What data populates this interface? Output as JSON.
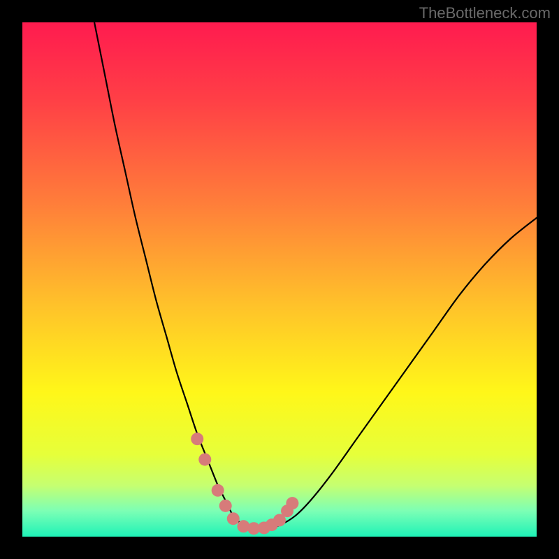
{
  "watermark": "TheBottleneck.com",
  "chart_data": {
    "type": "line",
    "title": "",
    "xlabel": "",
    "ylabel": "",
    "xlim": [
      0,
      100
    ],
    "ylim": [
      0,
      100
    ],
    "curve": {
      "x": [
        14,
        16,
        18,
        20,
        22,
        24,
        26,
        28,
        30,
        32,
        34,
        36,
        38,
        39,
        40,
        41,
        42,
        43,
        44,
        45,
        46,
        48,
        50,
        53,
        56,
        60,
        65,
        70,
        75,
        80,
        85,
        90,
        95,
        100
      ],
      "y": [
        100,
        90,
        80,
        71,
        62,
        54,
        46,
        39,
        32,
        26,
        20,
        15,
        10,
        8,
        6,
        4,
        3,
        2.2,
        1.8,
        1.6,
        1.6,
        1.7,
        2.2,
        4,
        7,
        12,
        19,
        26,
        33,
        40,
        47,
        53,
        58,
        62
      ]
    },
    "highlight_points": {
      "x": [
        34.0,
        35.5,
        38.0,
        39.5,
        41.0,
        43.0,
        45.0,
        47.0,
        48.5,
        50.0,
        51.5,
        52.5
      ],
      "y": [
        19.0,
        15.0,
        9.0,
        6.0,
        3.5,
        2.0,
        1.6,
        1.7,
        2.3,
        3.2,
        5.0,
        6.5
      ]
    },
    "gradient_stops": [
      {
        "offset": 0.0,
        "color": "#ff1b4f"
      },
      {
        "offset": 0.15,
        "color": "#ff3f46"
      },
      {
        "offset": 0.35,
        "color": "#ff7d3a"
      },
      {
        "offset": 0.55,
        "color": "#ffc22a"
      },
      {
        "offset": 0.72,
        "color": "#fff719"
      },
      {
        "offset": 0.84,
        "color": "#e6ff3a"
      },
      {
        "offset": 0.9,
        "color": "#c6ff70"
      },
      {
        "offset": 0.95,
        "color": "#7cffb5"
      },
      {
        "offset": 1.0,
        "color": "#1ef2b7"
      }
    ],
    "highlight_color": "#d77b7a",
    "highlight_radius_px": 9
  }
}
